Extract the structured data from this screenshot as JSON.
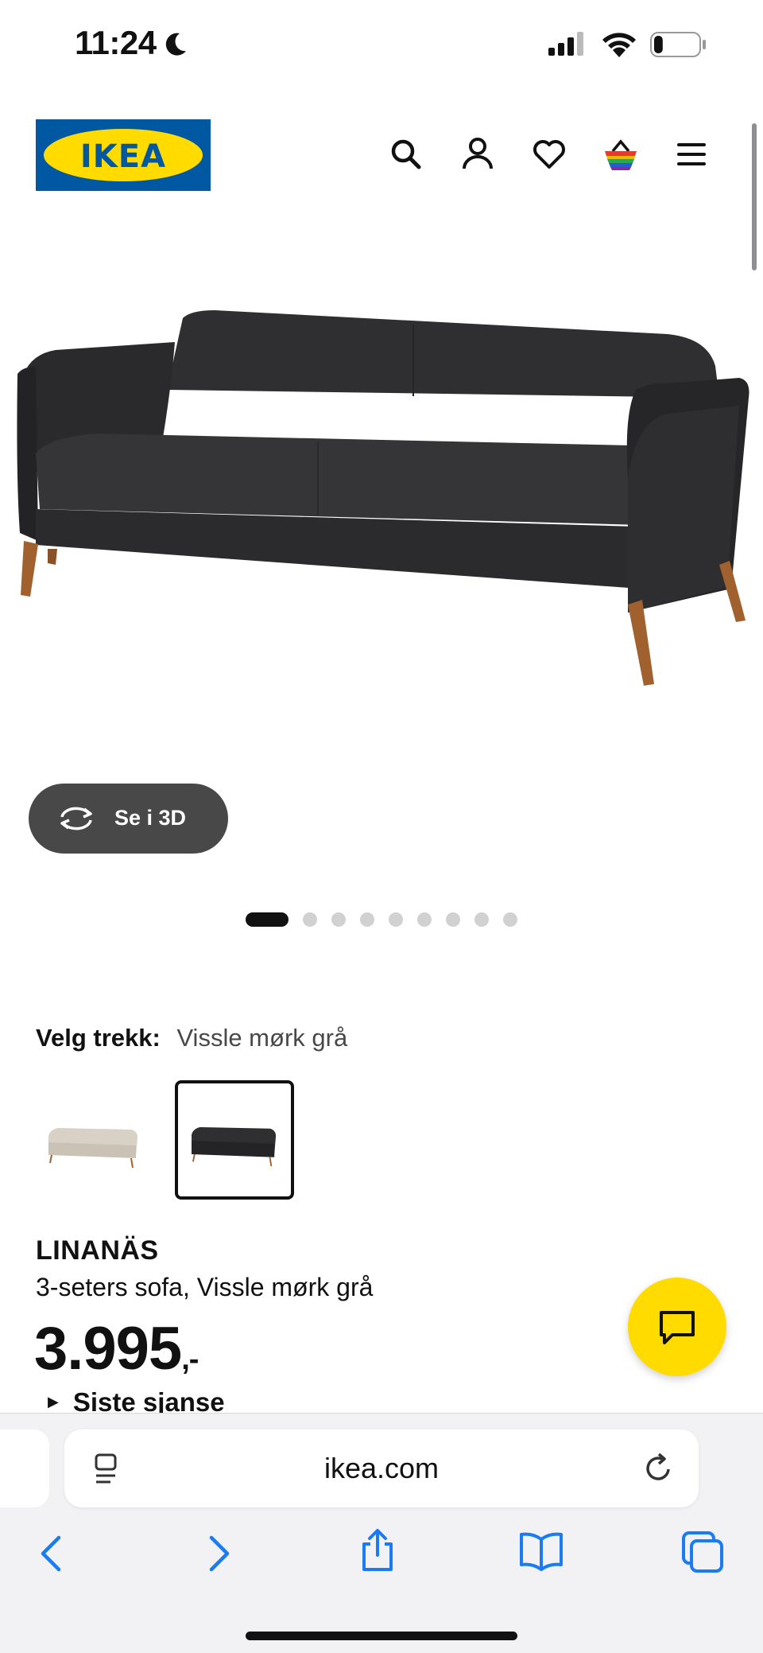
{
  "status_bar": {
    "time": "11:24",
    "battery_level": 0.2
  },
  "header": {
    "logo_text": "IKEA",
    "icons": [
      "search-icon",
      "account-icon",
      "heart-icon",
      "basket-icon",
      "menu-icon"
    ]
  },
  "gallery": {
    "view_3d_label": "Se i 3D",
    "slide_count": 9,
    "active_slide": 1
  },
  "variant": {
    "label": "Velg trekk:",
    "selected": "Vissle mørk grå",
    "options": [
      "beige",
      "dark-grey"
    ],
    "selected_index": 1
  },
  "product": {
    "name": "LINANÄS",
    "description": "3-seters sofa, Vissle mørk grå",
    "price": "3.995",
    "price_suffix": ",-",
    "badge": "Siste sjanse"
  },
  "browser": {
    "url": "ikea.com"
  },
  "colors": {
    "ikea_blue": "#0058a3",
    "ikea_yellow": "#ffdb00",
    "sofa_dark": "#2b2b2d",
    "sofa_beige": "#d8d2c6",
    "safari_blue": "#1a7bf2"
  }
}
